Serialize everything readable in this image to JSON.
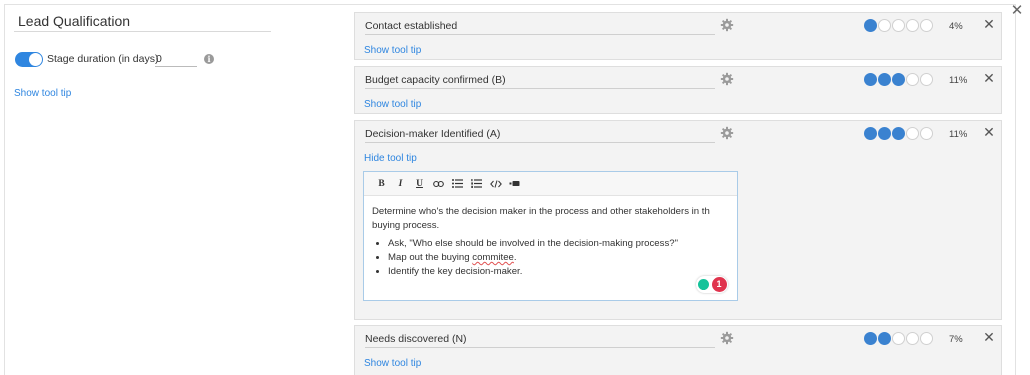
{
  "stage": {
    "title": "Lead Qualification",
    "duration_label": "Stage duration (in days)",
    "duration_value": "0",
    "tooltip_link": "Show tool tip"
  },
  "criteria": [
    {
      "name": "Contact established",
      "rating": 1,
      "rating_max": 5,
      "percent": "4%",
      "tip_link": "Show tool tip"
    },
    {
      "name": "Budget capacity confirmed (B)",
      "rating": 3,
      "rating_max": 5,
      "percent": "11%",
      "tip_link": "Show tool tip"
    },
    {
      "name": "Decision-maker Identified (A)",
      "rating": 3,
      "rating_max": 5,
      "percent": "11%",
      "tip_link": "Hide tool tip",
      "editor": {
        "toolbar": [
          "B",
          "I",
          "U",
          "link",
          "bulleted-list",
          "numbered-list",
          "code",
          "clear-format"
        ],
        "paragraph": "Determine who's the decision maker in the process and other stakeholders in th buying process.",
        "bullets": [
          "Ask, \"Who else should be involved in the decision-making process?\"",
          "Map out the buying ",
          "Identify the key decision-maker."
        ],
        "misspelled_word": "commitee",
        "after_misspelled": ".",
        "grammar_count": "1"
      }
    },
    {
      "name": "Needs discovered (N)",
      "rating": 2,
      "rating_max": 5,
      "percent": "7%",
      "tip_link": "Show tool tip"
    }
  ],
  "colors": {
    "accent": "#2f86e0",
    "rating_on": "#3a82d0",
    "grammar_green": "#15c39a",
    "grammar_red": "#e0334d"
  }
}
